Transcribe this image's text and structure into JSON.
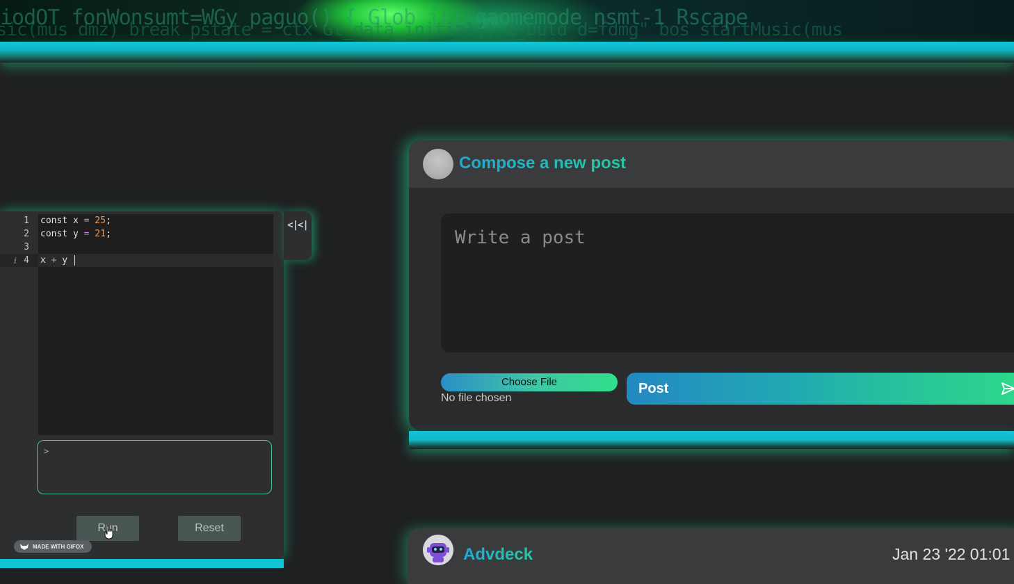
{
  "banner": {
    "code_line_1": "iodOT fonWonsumt=WGy paguo() { Glob_jrl gaomemode nsmt-1 Rscape",
    "code_line_2": "usic(mus  dmz) break pstate = ctx Gt_data_initial() C_Duld  d=fdmg\" bos  startMusic(mus"
  },
  "sandbox": {
    "collapse_icon_text": "<|<|",
    "line_numbers": [
      "1",
      "2",
      "3",
      "4"
    ],
    "info_marker": "i",
    "code": {
      "l1_kw": "const x ",
      "l1_op": "=",
      "l1_num": " 25",
      "l1_end": ";",
      "l2_kw": "const y ",
      "l2_op": "=",
      "l2_num": " 21",
      "l2_end": ";",
      "l4_a": "x ",
      "l4_op": "+",
      "l4_b": " y "
    },
    "console_prompt": ">",
    "run_label": "Run",
    "reset_label": "Reset",
    "badge_label": "MADE WITH GIFOX"
  },
  "compose": {
    "title": "Compose a new post",
    "placeholder": "Write a post",
    "choose_file_label": "Choose File",
    "no_file_text": "No file chosen",
    "post_label": "Post"
  },
  "post": {
    "author": "Advdeck",
    "timestamp": "Jan 23 '22 01:01"
  },
  "colors": {
    "accent_cyan": "#10c4d4",
    "accent_green": "#2fd98a",
    "background": "#1f2022"
  }
}
